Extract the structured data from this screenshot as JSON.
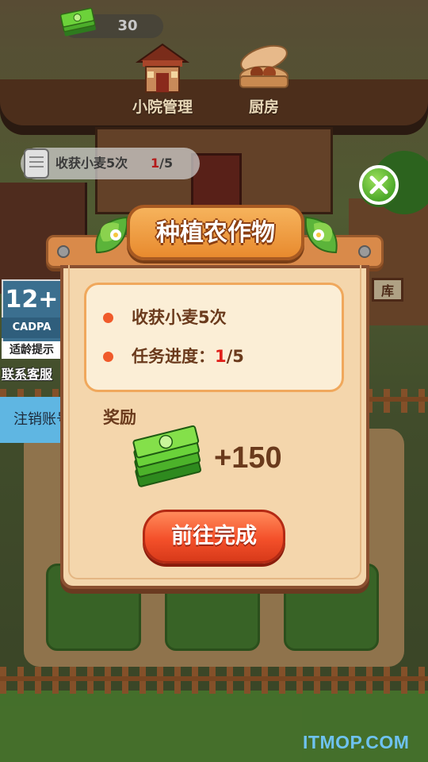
{
  "hud": {
    "currency_value": "30",
    "currency_icon": "cash-stack-icon",
    "nav": [
      {
        "label": "小院管理",
        "icon": "courtyard-house-icon"
      },
      {
        "label": "厨房",
        "icon": "steamer-basket-icon"
      }
    ]
  },
  "task_tracker": {
    "text": "收获小麦5次",
    "progress_done": "1",
    "progress_total": "/5"
  },
  "side": {
    "age_rating": "12+",
    "age_org": "CADPA",
    "age_tip": "适龄提示",
    "contact_link": "联系客服",
    "cancel_account": "注销账号"
  },
  "scene": {
    "warehouse_sign": "库"
  },
  "popup": {
    "title": "种植农作物",
    "task_line": "收获小麦5次",
    "progress_label": "任务进度：",
    "progress_done": "1",
    "progress_total": "/5",
    "reward_label": "奖励",
    "reward_amount": "+150",
    "go_button": "前往完成",
    "colors": {
      "panel": "#f4d6ac",
      "title_plate": "#e88a2e",
      "button": "#f4502a",
      "close": "#4ca82a"
    }
  },
  "watermark": "ITMOP.COM"
}
